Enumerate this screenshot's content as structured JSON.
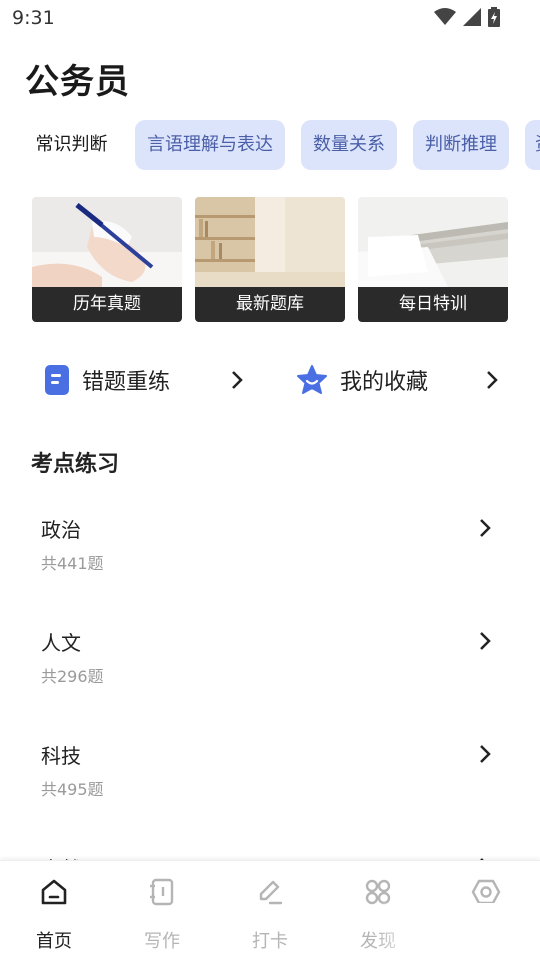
{
  "status": {
    "time": "9:31"
  },
  "page": {
    "title": "公务员"
  },
  "chips": [
    {
      "label": "常识判断",
      "active": true
    },
    {
      "label": "言语理解与表达",
      "active": false
    },
    {
      "label": "数量关系",
      "active": false
    },
    {
      "label": "判断推理",
      "active": false
    },
    {
      "label": "资料分析",
      "active": false
    }
  ],
  "cards": [
    {
      "label": "历年真题"
    },
    {
      "label": "最新题库"
    },
    {
      "label": "每日特训"
    }
  ],
  "quick_actions": {
    "wrong_practice": "错题重练",
    "favorites": "我的收藏"
  },
  "section": {
    "title": "考点练习"
  },
  "topics": [
    {
      "title": "政治",
      "count": "共441题"
    },
    {
      "title": "人文",
      "count": "共296题"
    },
    {
      "title": "科技",
      "count": "共495题"
    },
    {
      "title": "自然",
      "count": ""
    }
  ],
  "tabs": [
    {
      "label": "首页",
      "icon": "home-icon",
      "active": true
    },
    {
      "label": "写作",
      "icon": "notebook-icon",
      "active": false
    },
    {
      "label": "打卡",
      "icon": "pen-icon",
      "active": false
    },
    {
      "label": "发现",
      "icon": "grid-icon",
      "active": false
    },
    {
      "label": "",
      "icon": "settings-icon",
      "active": false
    }
  ],
  "colors": {
    "chip_bg": "#dce4fb",
    "chip_text": "#4a5fa8",
    "accent_blue": "#4a6fe3"
  }
}
